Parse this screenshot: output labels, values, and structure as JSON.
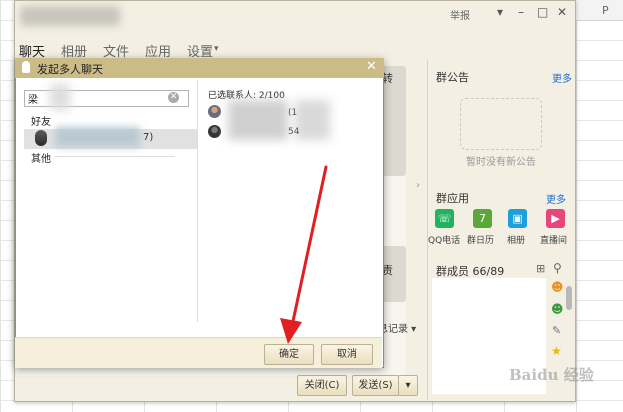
{
  "sheet": {
    "column_p": "P"
  },
  "window": {
    "report": "举报",
    "controls": [
      "▾",
      "–",
      "□",
      "✕"
    ],
    "menu": [
      {
        "label": "聊天"
      },
      {
        "label": "相册"
      },
      {
        "label": "文件"
      },
      {
        "label": "应用"
      },
      {
        "label": "设置"
      }
    ],
    "settings_arrow": "▾",
    "card1_text": "转",
    "card2_text": "责",
    "history_link": "息记录 ▾",
    "close_button": "关闭(C)",
    "send_button": "发送(S)",
    "send_arrow": "▾"
  },
  "right_panel": {
    "notice_title": "群公告",
    "notice_more": "更多",
    "notice_empty": "暂时没有新公告",
    "apps_title": "群应用",
    "apps_more": "更多",
    "apps": [
      {
        "label": "QQ电话",
        "icon": "phone-icon",
        "color": "#22b35e",
        "glyph": "☏"
      },
      {
        "label": "群日历",
        "icon": "calendar-icon",
        "color": "#5aa83a",
        "glyph": "7"
      },
      {
        "label": "相册",
        "icon": "photo-icon",
        "color": "#1ca0d8",
        "glyph": "▣"
      },
      {
        "label": "直播间",
        "icon": "video-icon",
        "color": "#e8457b",
        "glyph": "▶"
      }
    ],
    "members_title": "群成员 66/89",
    "member_icons": [
      "member-orange-icon",
      "member-green-icon",
      "edit-icon",
      "star-icon"
    ]
  },
  "dialog": {
    "title": "发起多人聊天",
    "close": "✕",
    "search_value": "梁",
    "clear": "✕",
    "group_friends": "好友",
    "friend_row_suffix": "7)",
    "group_other": "其他",
    "selected_label": "已选联系人: 2/100",
    "selected": [
      {
        "suffix": "(1"
      },
      {
        "suffix": "54"
      }
    ],
    "confirm": "确定",
    "cancel": "取消"
  },
  "watermark": "Baidu 经验",
  "colors": {
    "dialog_header": "#cbbb86",
    "link_blue": "#1e6fd8",
    "arrow_red": "#e02020"
  }
}
